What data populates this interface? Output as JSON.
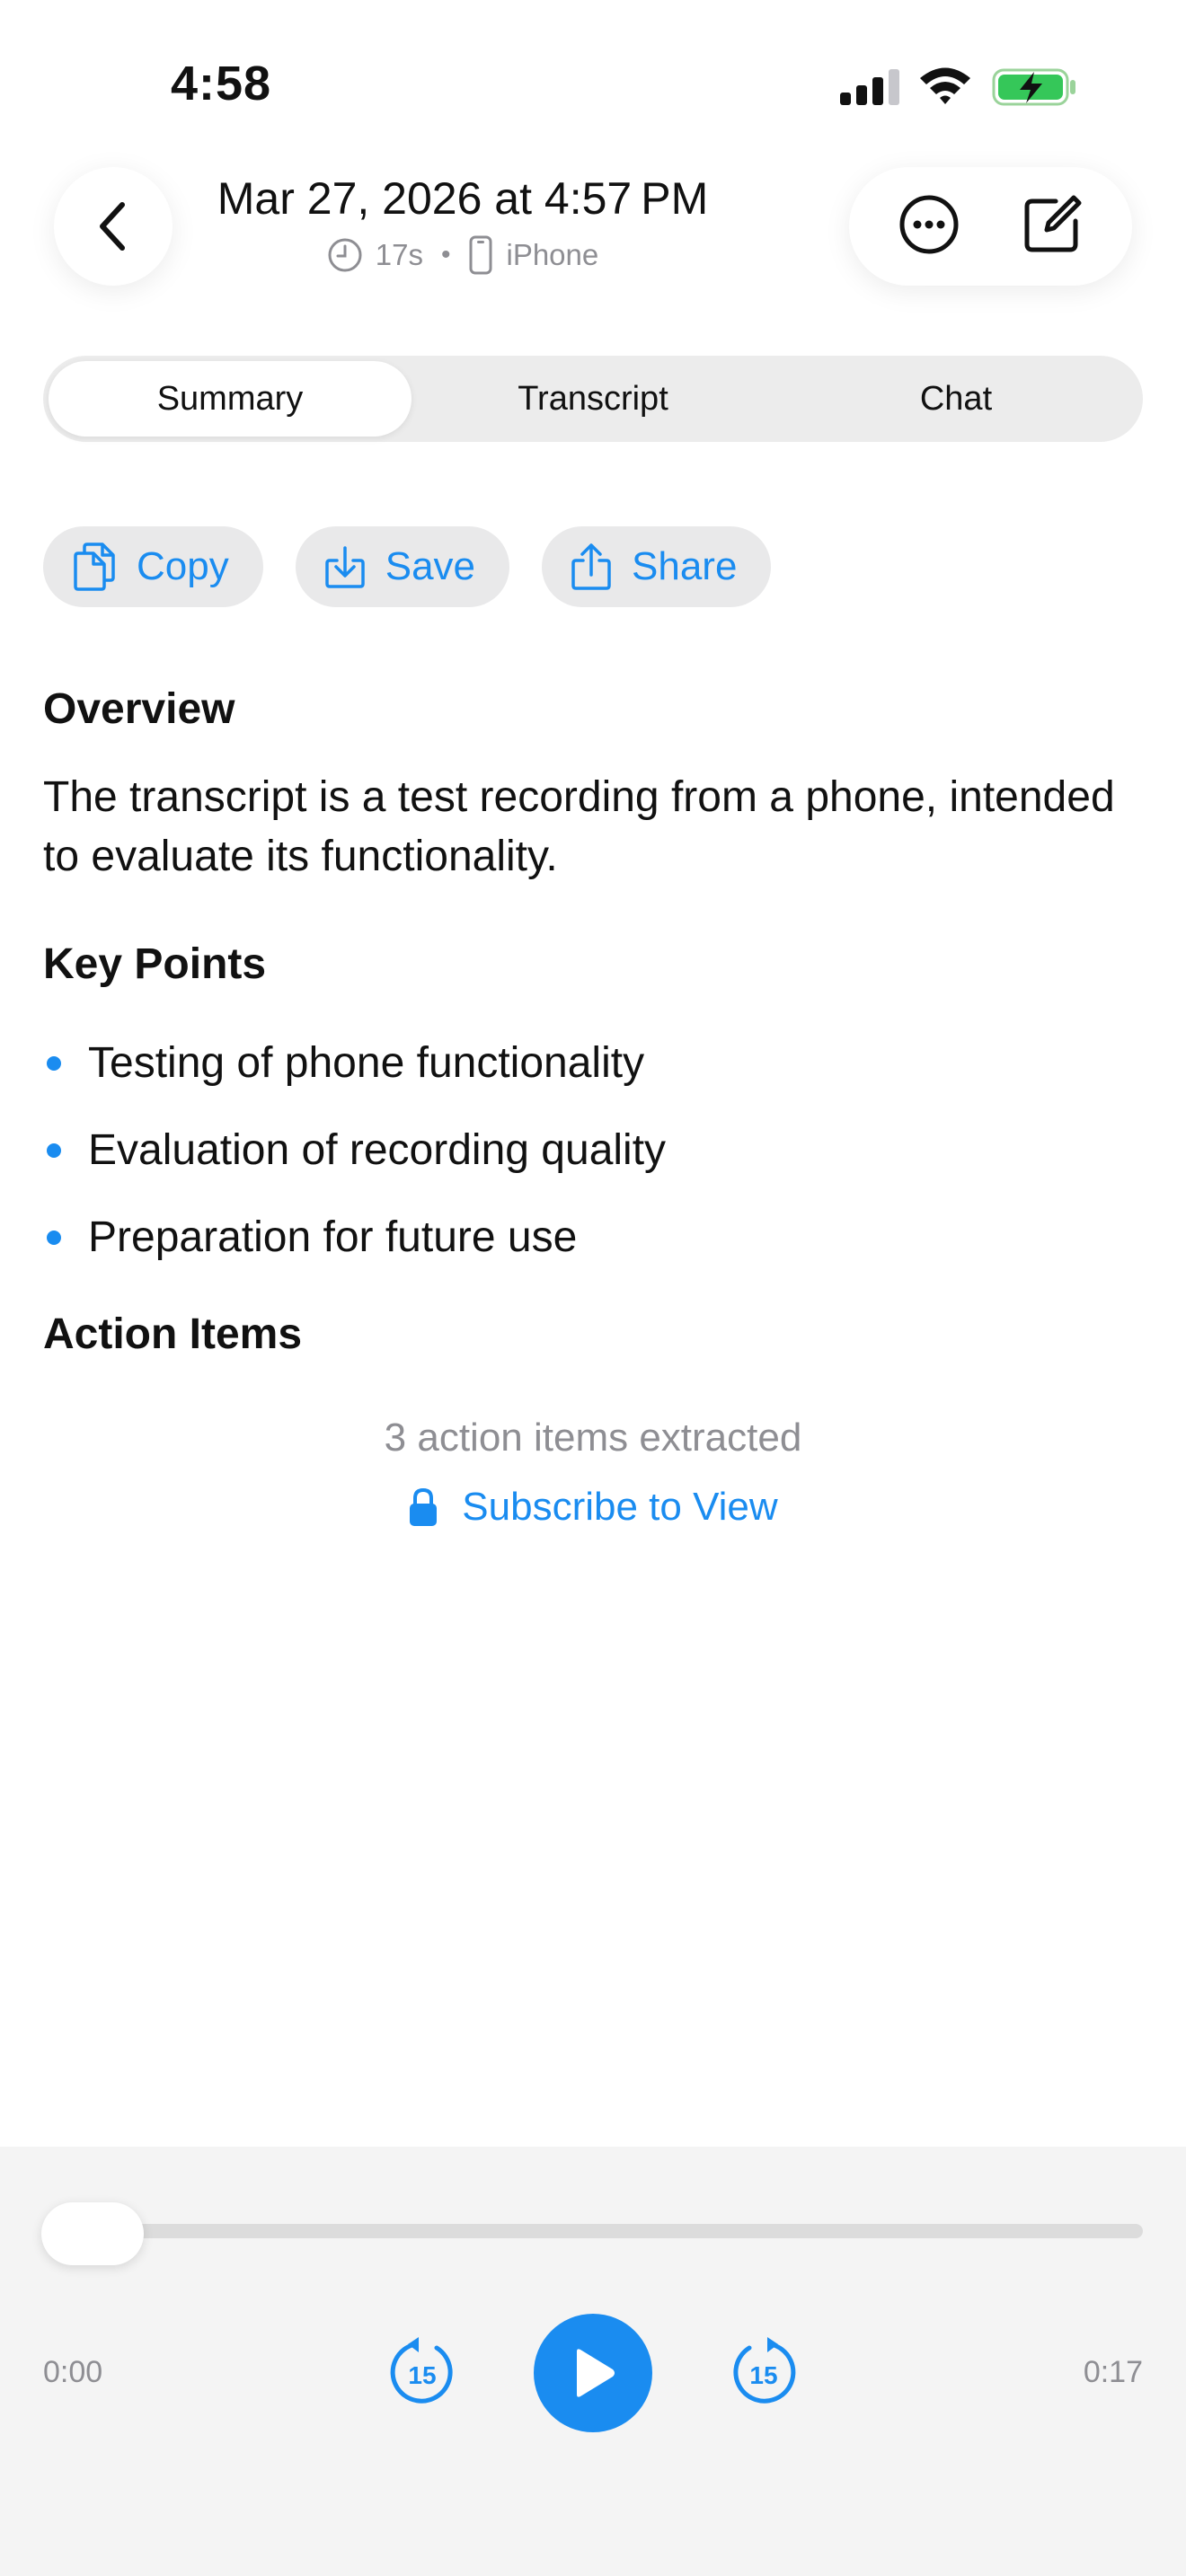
{
  "status_bar": {
    "time": "4:58",
    "icons": [
      "cellular-signal-icon",
      "wifi-icon",
      "battery-charging-icon"
    ]
  },
  "header": {
    "title": "Mar 27, 2026 at 4:57 PM",
    "duration": "17s",
    "separator": "•",
    "device": "iPhone",
    "back_icon": "chevron-left-icon",
    "more_icon": "ellipsis-circle-icon",
    "edit_icon": "compose-icon"
  },
  "tabs": [
    {
      "label": "Summary",
      "active": true
    },
    {
      "label": "Transcript",
      "active": false
    },
    {
      "label": "Chat",
      "active": false
    }
  ],
  "actions": [
    {
      "label": "Copy",
      "icon": "copy-icon"
    },
    {
      "label": "Save",
      "icon": "download-icon"
    },
    {
      "label": "Share",
      "icon": "share-icon"
    }
  ],
  "summary": {
    "overview_heading": "Overview",
    "overview_text": "The transcript is a test recording from a phone, intended to evaluate its functionality.",
    "key_points_heading": "Key Points",
    "key_points": [
      "Testing of phone functionality",
      "Evaluation of recording quality",
      "Preparation for future use"
    ],
    "action_items_heading": "Action Items",
    "action_items_count_text": "3 action items extracted",
    "subscribe_label": "Subscribe to View",
    "subscribe_icon": "lock-icon"
  },
  "player": {
    "current_time": "0:00",
    "total_time": "0:17",
    "progress": 0,
    "skip_back_label": "15",
    "skip_forward_label": "15",
    "play_icon": "play-icon"
  },
  "colors": {
    "accent": "#1a8cf0",
    "muted_text": "#8e8e93",
    "pill_bg": "#e9e9ea",
    "player_bg": "#f4f4f4"
  }
}
